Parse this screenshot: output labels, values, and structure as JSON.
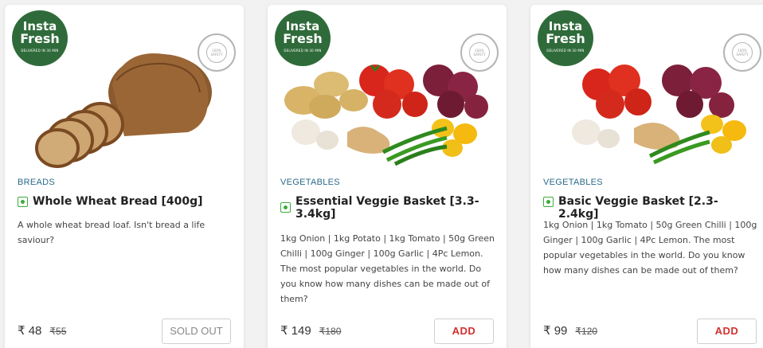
{
  "brand": {
    "logo_line1": "Insta",
    "logo_line2": "Fresh",
    "logo_tagline": "DELIVERED IN 30 MIN",
    "stamp_text": "ZERO CONTACT DELIVERY",
    "stamp_center": "100% SAFETY",
    "logo_color": "#2f6b3a"
  },
  "products": [
    {
      "image": "bread-loaf-image",
      "category": "BREADS",
      "title": "Whole Wheat Bread [400g]",
      "description": "A whole wheat bread loaf. Isn't bread a life saviour?",
      "price": "₹ 48",
      "mrp": "₹55",
      "action": "SOLD OUT",
      "available": false
    },
    {
      "image": "essential-veggie-basket-image",
      "category": "VEGETABLES",
      "title": "Essential Veggie Basket [3.3-3.4kg]",
      "description": "1kg Onion | 1kg Potato | 1kg Tomato | 50g Green Chilli | 100g Ginger | 100g Garlic | 4Pc Lemon. The most popular vegetables in the world. Do you know how many dishes can be made out of them?",
      "price": "₹ 149",
      "mrp": "₹180",
      "action": "ADD",
      "available": true
    },
    {
      "image": "basic-veggie-basket-image",
      "category": "VEGETABLES",
      "title": "Basic Veggie Basket [2.3-2.4kg]",
      "description": "1kg Onion | 1kg Tomato | 50g Green Chilli | 100g Ginger | 100g Garlic | 4Pc Lemon. The most popular vegetables in the world. Do you know how many dishes can be made out of them?",
      "price": "₹ 99",
      "mrp": "₹120",
      "action": "ADD",
      "available": true
    }
  ],
  "colors": {
    "category": "#2b6a8a",
    "veg_indicator": "#3cab3c",
    "add_button": "#d32f2f",
    "sold_out": "#888888"
  }
}
